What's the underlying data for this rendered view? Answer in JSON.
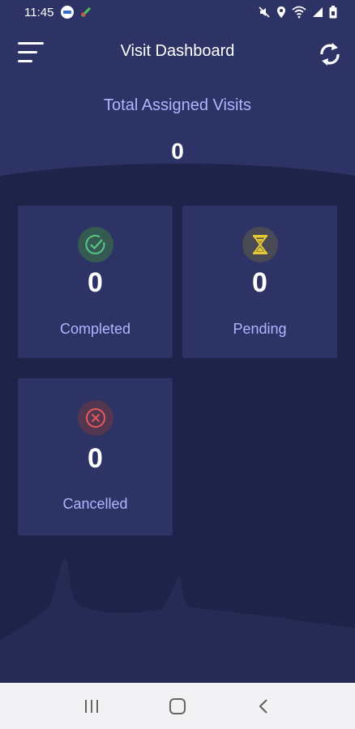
{
  "status_bar": {
    "time": "11:45"
  },
  "header": {
    "title": "Visit Dashboard",
    "total_label": "Total Assigned Visits",
    "total_value": "0"
  },
  "cards": {
    "completed": {
      "count": "0",
      "label": "Completed",
      "icon": "check-circle-icon",
      "color": "#5ac483"
    },
    "pending": {
      "count": "0",
      "label": "Pending",
      "icon": "hourglass-icon",
      "color": "#e6c832"
    },
    "cancelled": {
      "count": "0",
      "label": "Cancelled",
      "icon": "x-circle-icon",
      "color": "#e25a5a"
    }
  },
  "colors": {
    "background": "#1f2349",
    "header": "#2e3366",
    "card": "#2e3366",
    "label": "#aeb6ff"
  }
}
